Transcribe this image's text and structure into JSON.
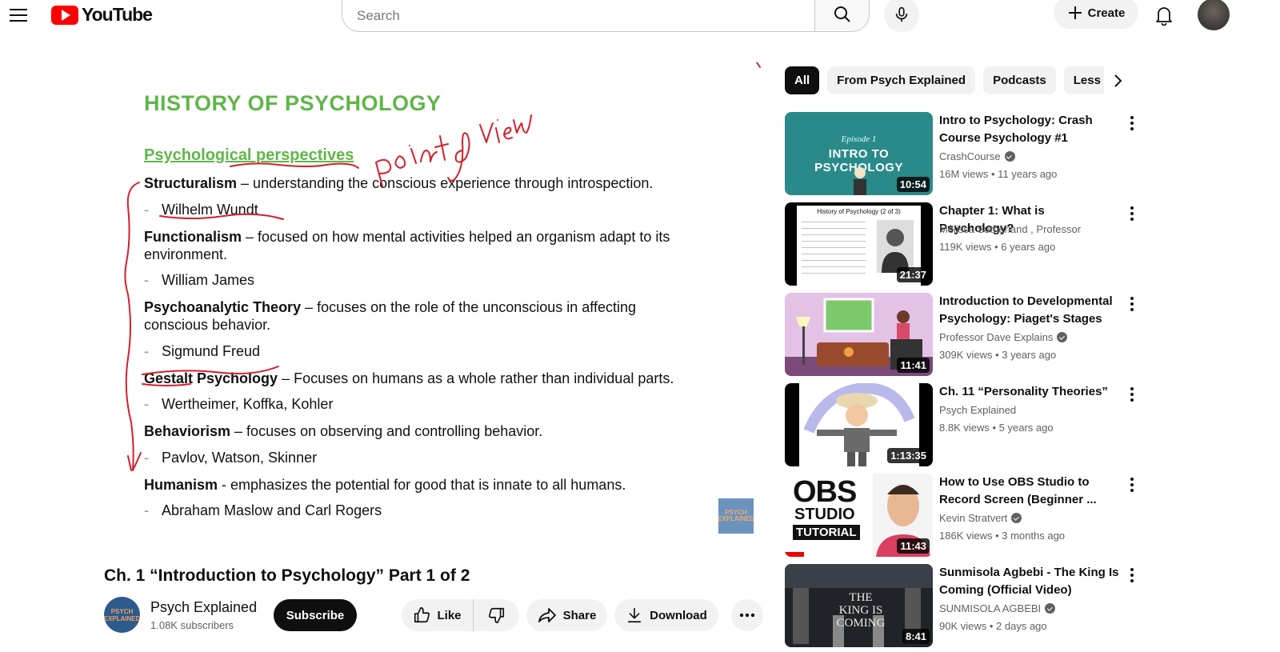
{
  "header": {
    "logo_text": "YouTube",
    "search_placeholder": "Search",
    "create_label": "Create"
  },
  "slide": {
    "title": "HISTORY OF PSYCHOLOGY",
    "subtitle": "Psychological perspectives",
    "annotation": "point of view",
    "items": [
      {
        "term": "Structuralism",
        "desc": " – understanding the conscious experience through introspection.",
        "people": "Wilhelm Wundt"
      },
      {
        "term": "Functionalism",
        "desc": " – focused on how mental activities helped an organism adapt to its environment.",
        "people": "William James"
      },
      {
        "term": "Psychoanalytic Theory",
        "desc": " – focuses on the role of the unconscious in affecting conscious behavior.",
        "people": "Sigmund Freud"
      },
      {
        "term": "Gestalt Psychology",
        "desc": " – Focuses on humans as a whole rather than individual parts.",
        "people": "Wertheimer, Koffka, Kohler"
      },
      {
        "term": "Behaviorism",
        "desc": " – focuses on observing and controlling behavior.",
        "people": "Pavlov, Watson, Skinner"
      },
      {
        "term": "Humanism",
        "desc": " - emphasizes the potential for good that is innate to all humans.",
        "people": "Abraham Maslow and Carl Rogers"
      }
    ],
    "watermark": "PSYCH EXPLAINED"
  },
  "video": {
    "title": "Ch. 1 “Introduction to Psychology” Part 1 of 2",
    "channel_name": "Psych Explained",
    "subscribers": "1.08K subscribers",
    "subscribe_label": "Subscribe",
    "like_label": "Like",
    "share_label": "Share",
    "download_label": "Download"
  },
  "chips": [
    "All",
    "From Psych Explained",
    "Podcasts",
    "Less"
  ],
  "recommendations": [
    {
      "title": "Intro to Psychology: Crash Course Psychology #1",
      "channel": "CrashCourse",
      "verified": true,
      "meta": "16M views • 11 years ago",
      "duration": "10:54",
      "thumb_text_small": "Episode 1",
      "thumb_text": "INTRO TO PSYCHOLOGY"
    },
    {
      "title": "Chapter 1: What is Psychology?",
      "channel": "Melissa Sutherland , Professor",
      "verified": false,
      "meta": "119K views • 6 years ago",
      "duration": "21:37",
      "thumb_text": "History of Psychology (2 of 3)"
    },
    {
      "title": "Introduction to Developmental Psychology: Piaget's Stages",
      "channel": "Professor Dave Explains",
      "verified": true,
      "meta": "309K views • 3 years ago",
      "duration": "11:41"
    },
    {
      "title": "Ch. 11 “Personality Theories”",
      "channel": "Psych Explained",
      "verified": false,
      "meta": "8.8K views • 5 years ago",
      "duration": "1:13:35"
    },
    {
      "title": "How to Use OBS Studio to Record Screen (Beginner ...",
      "channel": "Kevin Stratvert",
      "verified": true,
      "meta": "186K views • 3 months ago",
      "duration": "11:43",
      "thumb_lines": [
        "OBS",
        "STUDIO",
        "TUTORIAL"
      ]
    },
    {
      "title": "Sunmisola Agbebi - The King Is Coming (Official Video)",
      "channel": "SUNMISOLA AGBEBI",
      "verified": true,
      "meta": "90K views • 2 days ago",
      "duration": "8:41",
      "thumb_text": "THE KING IS COMING"
    }
  ],
  "colors": {
    "accent_red": "#ff0000",
    "slide_green": "#5fb648",
    "ink_red": "#d4202a"
  }
}
